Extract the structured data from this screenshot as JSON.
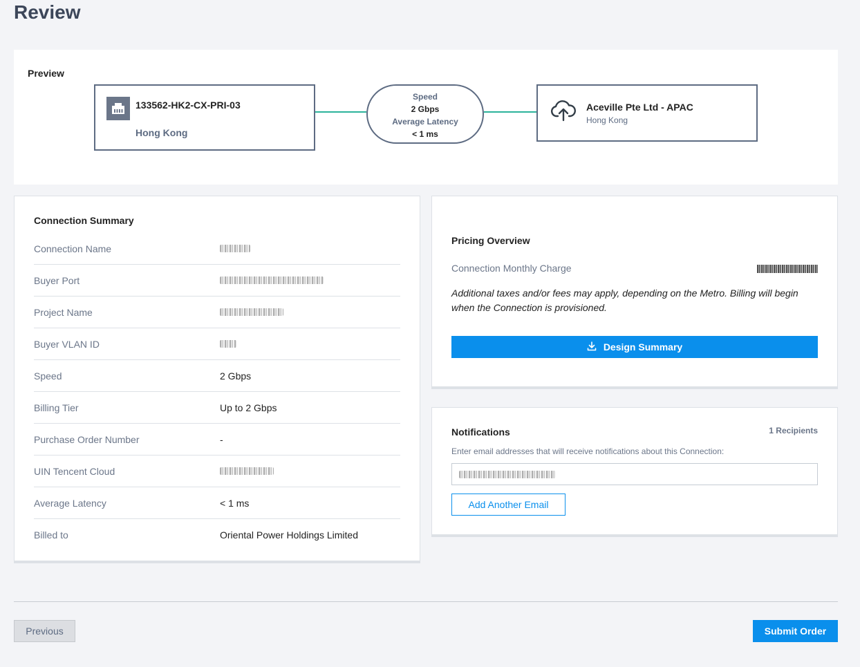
{
  "page": {
    "title": "Review"
  },
  "preview": {
    "label": "Preview",
    "port": {
      "name": "133562-HK2-CX-PRI-03",
      "metro": "Hong Kong"
    },
    "link": {
      "speed_label": "Speed",
      "speed_value": "2 Gbps",
      "latency_label": "Average Latency",
      "latency_value": "< 1 ms"
    },
    "provider": {
      "name": "Aceville Pte Ltd - APAC",
      "metro": "Hong Kong"
    },
    "colors": {
      "link_line": "#2bb39a",
      "node_border": "#5d6b82"
    }
  },
  "summary": {
    "title": "Connection Summary",
    "rows": [
      {
        "label": "Connection Name",
        "value": ""
      },
      {
        "label": "Buyer Port",
        "value": ""
      },
      {
        "label": "Project Name",
        "value": ""
      },
      {
        "label": "Buyer VLAN ID",
        "value": ""
      },
      {
        "label": "Speed",
        "value": "2 Gbps"
      },
      {
        "label": "Billing Tier",
        "value": "Up to 2 Gbps"
      },
      {
        "label": "Purchase Order Number",
        "value": "-"
      },
      {
        "label": "UIN Tencent Cloud",
        "value": ""
      },
      {
        "label": "Average Latency",
        "value": "< 1 ms"
      },
      {
        "label": "Billed to",
        "value": "Oriental Power Holdings Limited"
      }
    ]
  },
  "pricing": {
    "title": "Pricing Overview",
    "charge_label": "Connection Monthly Charge",
    "note": "Additional taxes and/or fees may apply, depending on the Metro. Billing will begin when the Connection is provisioned.",
    "design_button": "Design Summary",
    "icon": "download-icon"
  },
  "notifications": {
    "title": "Notifications",
    "recipients": "1 Recipients",
    "description": "Enter email addresses that will receive notifications about this Connection:",
    "email_value": "",
    "add_button": "Add Another Email"
  },
  "footer": {
    "previous": "Previous",
    "submit": "Submit Order"
  },
  "theme": {
    "primary": "#0a8fec",
    "heading": "#3c4659"
  }
}
